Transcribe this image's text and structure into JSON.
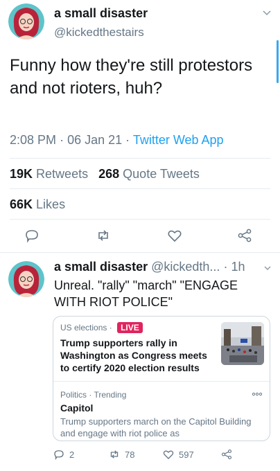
{
  "main_tweet": {
    "author_name": "a small disaster",
    "author_handle": "@kickedthestairs",
    "text": "Funny how they're still protestors and not rioters, huh?",
    "time": "2:08 PM",
    "date": "06 Jan 21",
    "source": "Twitter Web App",
    "retweets_count": "19K",
    "retweets_label": "Retweets",
    "quote_count": "268",
    "quote_label": "Quote Tweets",
    "likes_count": "66K",
    "likes_label": "Likes"
  },
  "reply_tweet": {
    "author_name": "a small disaster",
    "author_handle": "@kickedth...",
    "age": "1h",
    "text": "Unreal. \"rally\" \"march\" \"ENGAGE WITH RIOT POLICE\"",
    "card": {
      "category": "US elections",
      "live_label": "LIVE",
      "headline": "Trump supporters rally in Washington as Congress meets to certify 2020 election results",
      "secondary_meta": "Politics · Trending",
      "topic": "Capitol",
      "description": "Trump supporters march on the Capitol Building and engage with riot police as"
    },
    "reply_count": "2",
    "retweet_count": "78",
    "like_count": "597"
  },
  "colors": {
    "accent": "#1da1f2",
    "live": "#e0245e",
    "muted": "#657786"
  }
}
